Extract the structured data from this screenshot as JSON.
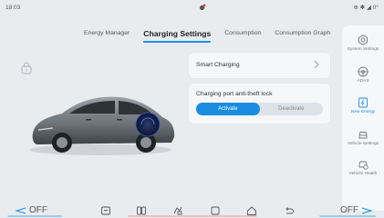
{
  "status": {
    "time": "18:03",
    "icons": "⊕ ✱ ◢ 0°"
  },
  "tabs": [
    {
      "label": "Energy Manager",
      "active": false
    },
    {
      "label": "Charging Settings",
      "active": true
    },
    {
      "label": "Consumption",
      "active": false
    },
    {
      "label": "Consumption Graph",
      "active": false
    }
  ],
  "smart_charging": {
    "label": "Smart Charging"
  },
  "anti_theft": {
    "label": "Charging port anti-theft lock",
    "options": [
      "Activate",
      "Deactivate"
    ],
    "selected": "Activate"
  },
  "sidebar": {
    "items": [
      {
        "label": "System Settings",
        "icon": "gear-icon"
      },
      {
        "label": "ADAS",
        "icon": "steering-wheel-icon"
      },
      {
        "label": "New Energy",
        "icon": "battery-icon",
        "active": true
      },
      {
        "label": "Vehicle Settings",
        "icon": "car-icon"
      },
      {
        "label": "Vehicle Health",
        "icon": "car-health-icon"
      }
    ]
  },
  "dock": {
    "left_label": "OFF",
    "right_label": "OFF",
    "icons": [
      "seat-icon",
      "split-screen-icon",
      "apps-icon",
      "square-icon",
      "home-icon",
      "back-icon"
    ]
  },
  "colors": {
    "accent": "#1a8de0",
    "background": "#e9ecef",
    "card": "#f5f7f9"
  }
}
